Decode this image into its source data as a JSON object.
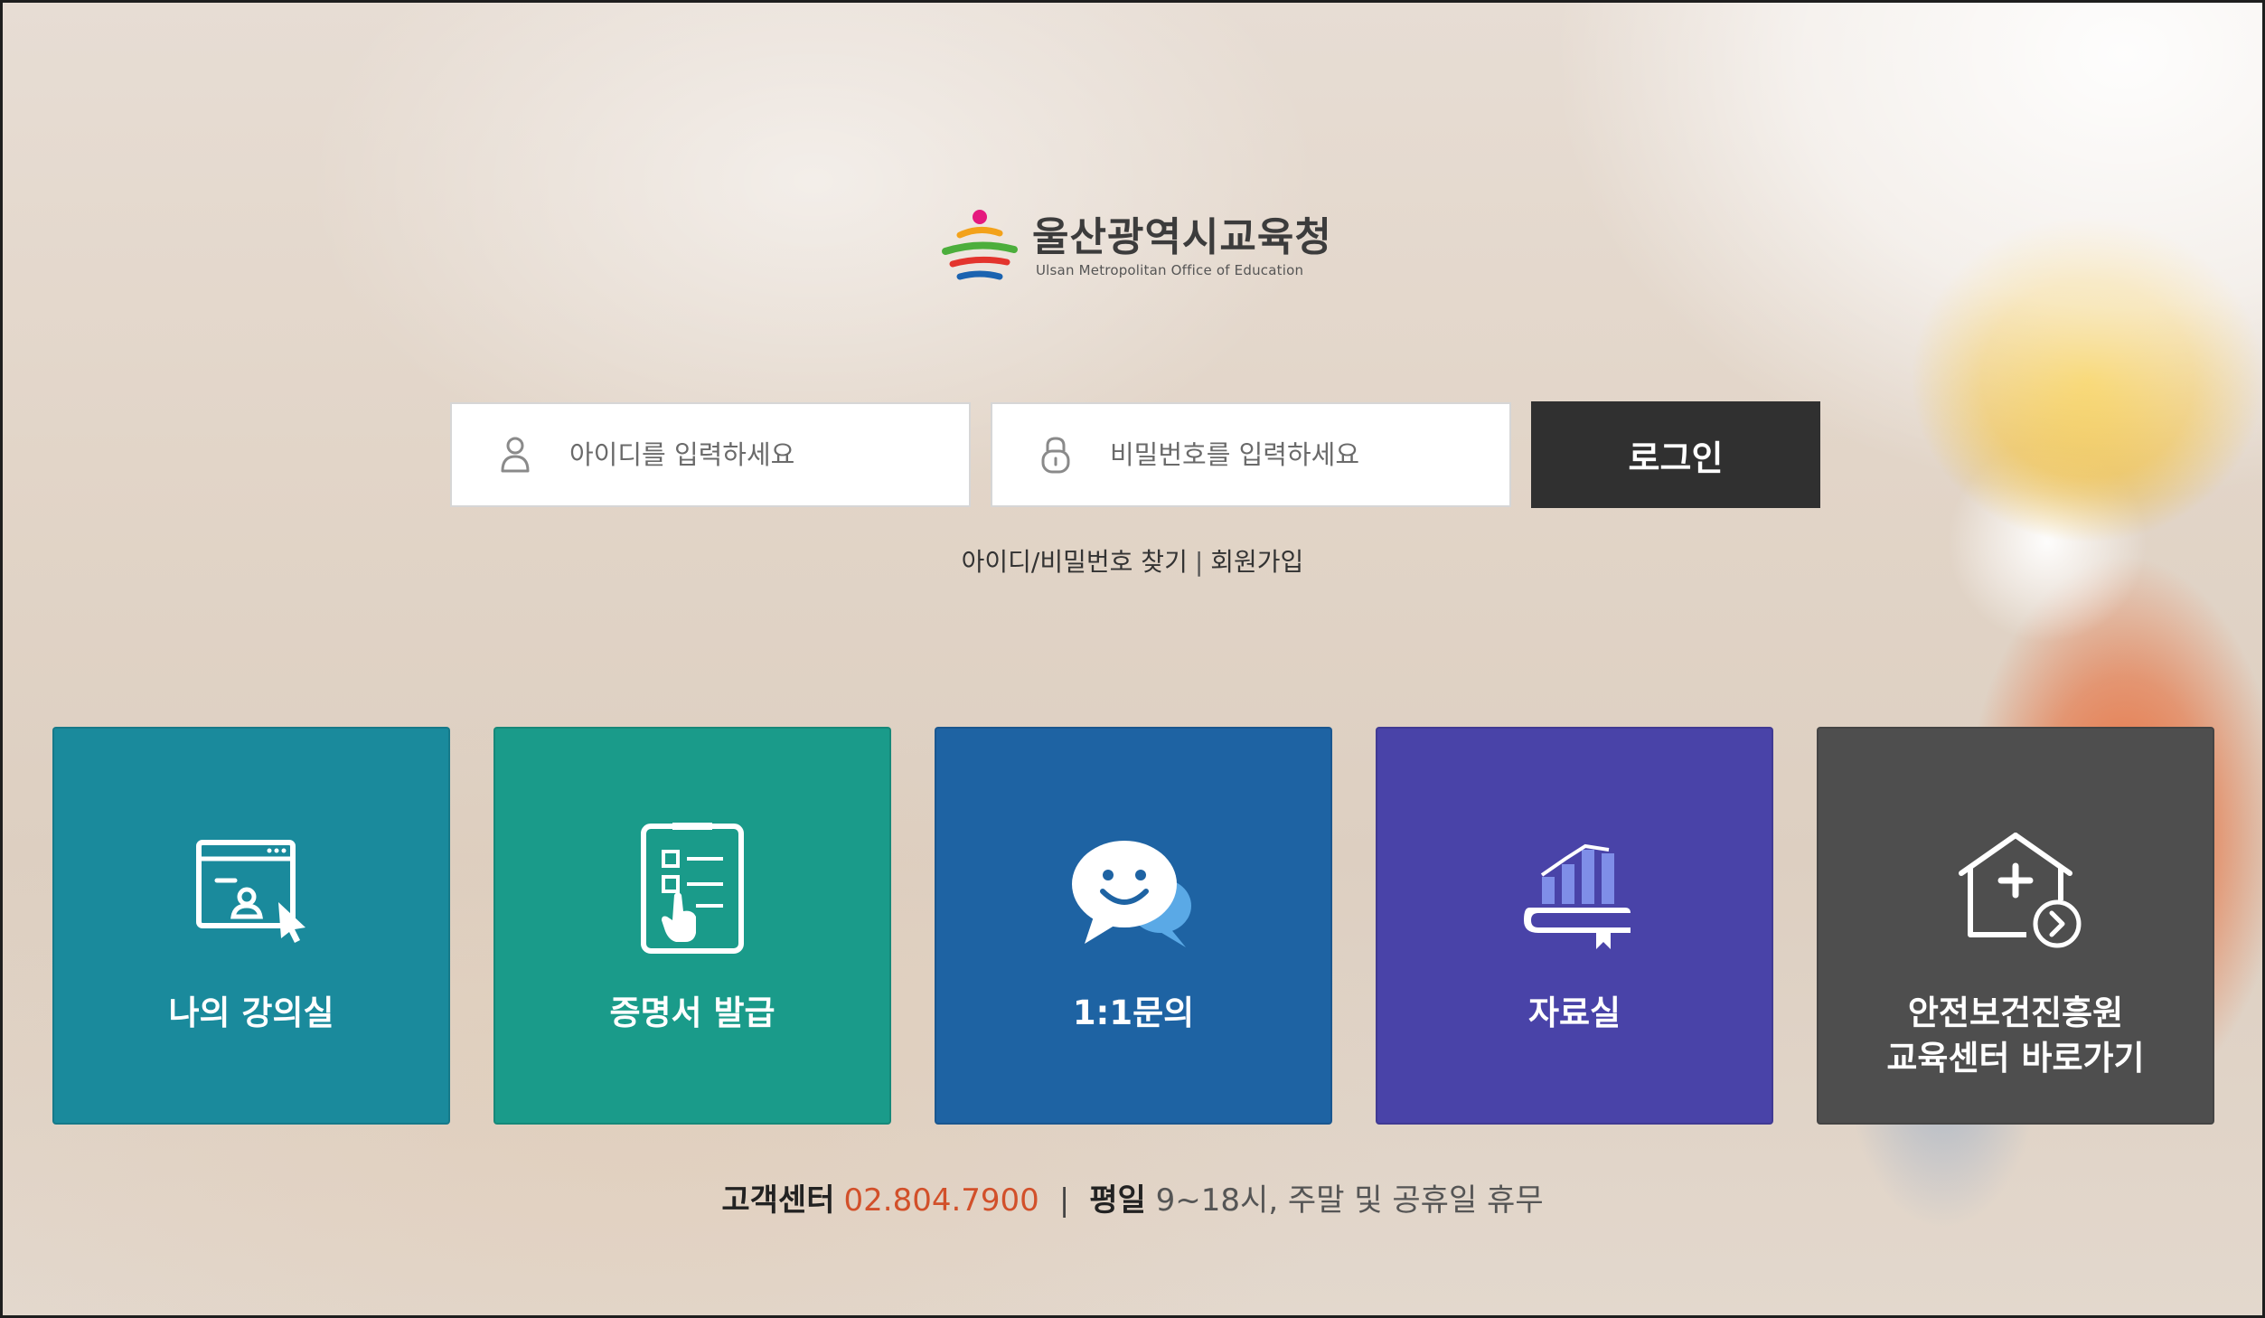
{
  "logo": {
    "title": "울산광역시교육청",
    "subtitle": "Ulsan Metropolitan Office of Education"
  },
  "login": {
    "id_placeholder": "아이디를 입력하세요",
    "password_placeholder": "비밀번호를 입력하세요",
    "button_label": "로그인",
    "find_link": "아이디/비밀번호 찾기",
    "separator": "|",
    "signup_link": "회원가입"
  },
  "tiles": [
    {
      "label": "나의 강의실",
      "color": "#1a8a9c",
      "icon": "classroom-icon"
    },
    {
      "label": "증명서 발급",
      "color": "#1a9b8a",
      "icon": "certificate-icon"
    },
    {
      "label": "1:1문의",
      "color": "#1e63a3",
      "icon": "chat-icon"
    },
    {
      "label": "자료실",
      "color": "#4943a8",
      "icon": "archive-icon"
    },
    {
      "label": "안전보건진흥원\n교육센터 바로가기",
      "color": "#4e4e4e",
      "icon": "home-link-icon"
    }
  ],
  "footer": {
    "center_label": "고객센터",
    "phone": "02.804.7900",
    "separator": "|",
    "weekday_label": "평일",
    "hours": "9~18시, 주말 및 공휴일 휴무"
  }
}
